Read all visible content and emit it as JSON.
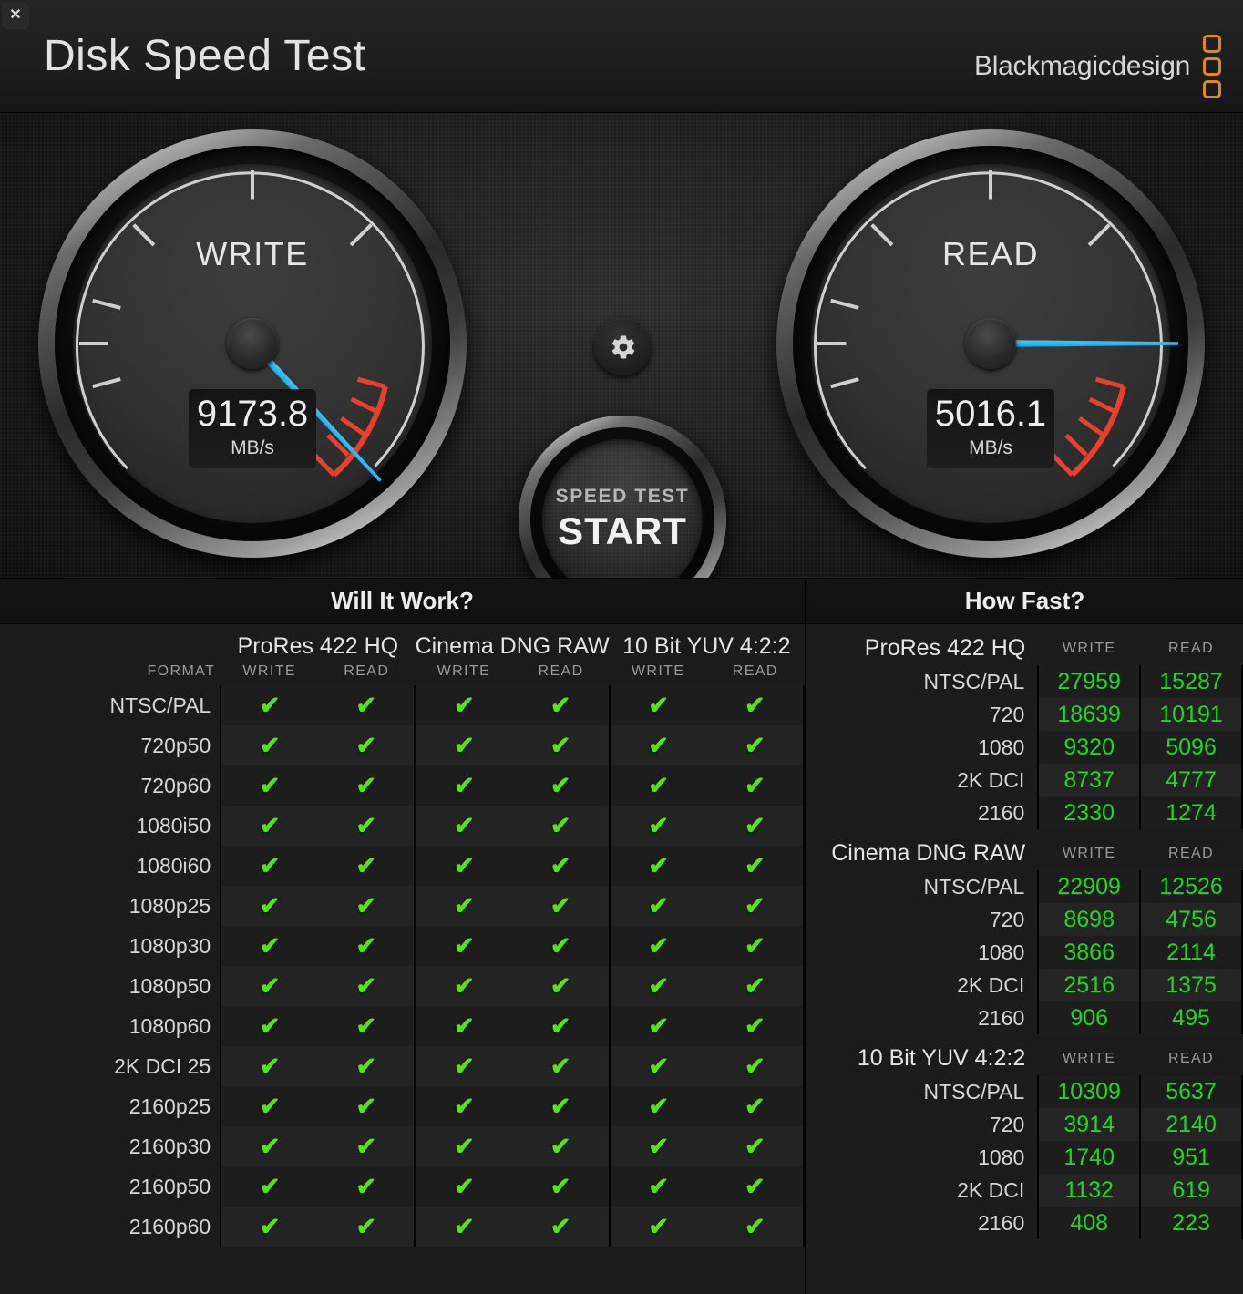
{
  "window": {
    "close_label": "✕",
    "title": "Disk Speed Test",
    "brand": "Blackmagicdesign",
    "brand_color": "#e08a16"
  },
  "gauges": {
    "write": {
      "label": "WRITE",
      "value": "9173.8",
      "unit": "MB/s",
      "needle_deg": 47,
      "needle_color": "#2ab8ef"
    },
    "read": {
      "label": "READ",
      "value": "5016.1",
      "unit": "MB/s",
      "needle_deg": 0,
      "needle_color": "#2ab8ef"
    }
  },
  "controls": {
    "gear_icon": "gear-icon",
    "start_line1": "SPEED TEST",
    "start_line2": "START"
  },
  "will_it_work": {
    "title": "Will It Work?",
    "format_header": "FORMAT",
    "codecs": [
      "ProRes 422 HQ",
      "Cinema DNG RAW",
      "10 Bit YUV 4:2:2"
    ],
    "sub_headers": [
      "WRITE",
      "READ"
    ],
    "check_glyph": "✔",
    "rows": [
      {
        "format": "NTSC/PAL",
        "cells": [
          true,
          true,
          true,
          true,
          true,
          true
        ]
      },
      {
        "format": "720p50",
        "cells": [
          true,
          true,
          true,
          true,
          true,
          true
        ]
      },
      {
        "format": "720p60",
        "cells": [
          true,
          true,
          true,
          true,
          true,
          true
        ]
      },
      {
        "format": "1080i50",
        "cells": [
          true,
          true,
          true,
          true,
          true,
          true
        ]
      },
      {
        "format": "1080i60",
        "cells": [
          true,
          true,
          true,
          true,
          true,
          true
        ]
      },
      {
        "format": "1080p25",
        "cells": [
          true,
          true,
          true,
          true,
          true,
          true
        ]
      },
      {
        "format": "1080p30",
        "cells": [
          true,
          true,
          true,
          true,
          true,
          true
        ]
      },
      {
        "format": "1080p50",
        "cells": [
          true,
          true,
          true,
          true,
          true,
          true
        ]
      },
      {
        "format": "1080p60",
        "cells": [
          true,
          true,
          true,
          true,
          true,
          true
        ]
      },
      {
        "format": "2K DCI 25",
        "cells": [
          true,
          true,
          true,
          true,
          true,
          true
        ]
      },
      {
        "format": "2160p25",
        "cells": [
          true,
          true,
          true,
          true,
          true,
          true
        ]
      },
      {
        "format": "2160p30",
        "cells": [
          true,
          true,
          true,
          true,
          true,
          true
        ]
      },
      {
        "format": "2160p50",
        "cells": [
          true,
          true,
          true,
          true,
          true,
          true
        ]
      },
      {
        "format": "2160p60",
        "cells": [
          true,
          true,
          true,
          true,
          true,
          true
        ]
      }
    ]
  },
  "how_fast": {
    "title": "How Fast?",
    "col_write": "WRITE",
    "col_read": "READ",
    "value_color": "#1ed91e",
    "groups": [
      {
        "codec": "ProRes 422 HQ",
        "rows": [
          {
            "format": "NTSC/PAL",
            "write": "27959",
            "read": "15287"
          },
          {
            "format": "720",
            "write": "18639",
            "read": "10191"
          },
          {
            "format": "1080",
            "write": "9320",
            "read": "5096"
          },
          {
            "format": "2K DCI",
            "write": "8737",
            "read": "4777"
          },
          {
            "format": "2160",
            "write": "2330",
            "read": "1274"
          }
        ]
      },
      {
        "codec": "Cinema DNG RAW",
        "rows": [
          {
            "format": "NTSC/PAL",
            "write": "22909",
            "read": "12526"
          },
          {
            "format": "720",
            "write": "8698",
            "read": "4756"
          },
          {
            "format": "1080",
            "write": "3866",
            "read": "2114"
          },
          {
            "format": "2K DCI",
            "write": "2516",
            "read": "1375"
          },
          {
            "format": "2160",
            "write": "906",
            "read": "495"
          }
        ]
      },
      {
        "codec": "10 Bit YUV 4:2:2",
        "rows": [
          {
            "format": "NTSC/PAL",
            "write": "10309",
            "read": "5637"
          },
          {
            "format": "720",
            "write": "3914",
            "read": "2140"
          },
          {
            "format": "1080",
            "write": "1740",
            "read": "951"
          },
          {
            "format": "2K DCI",
            "write": "1132",
            "read": "619"
          },
          {
            "format": "2160",
            "write": "408",
            "read": "223"
          }
        ]
      }
    ]
  }
}
